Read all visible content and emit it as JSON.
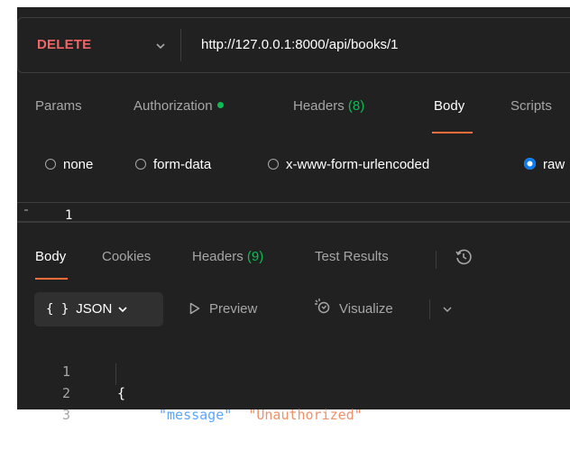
{
  "request": {
    "method": "DELETE",
    "url": "http://127.0.0.1:8000/api/books/1"
  },
  "request_tabs": [
    {
      "label": "Params",
      "active": false
    },
    {
      "label": "Authorization",
      "active": false
    },
    {
      "label": "Headers",
      "count": "(8)",
      "active": false
    },
    {
      "label": "Body",
      "active": true
    },
    {
      "label": "Scripts",
      "active": false
    }
  ],
  "body_types": [
    {
      "label": "none",
      "selected": false
    },
    {
      "label": "form-data",
      "selected": false
    },
    {
      "label": "x-www-form-urlencoded",
      "selected": false
    },
    {
      "label": "raw",
      "selected": true
    }
  ],
  "request_editor": {
    "line_number": "1"
  },
  "response_tabs": [
    {
      "label": "Body",
      "active": true
    },
    {
      "label": "Cookies",
      "active": false
    },
    {
      "label": "Headers",
      "count": "(9)",
      "active": false
    },
    {
      "label": "Test Results",
      "active": false
    }
  ],
  "response_toolbar": {
    "format_braces": "{ }",
    "format_label": "JSON",
    "preview_label": "Preview",
    "visualize_label": "Visualize"
  },
  "response_body": {
    "line_numbers": [
      "1",
      "2",
      "3"
    ],
    "open_brace": "{",
    "key": "\"message\"",
    "colon": ": ",
    "value": "\"Unauthorized\"",
    "close_brace": "}"
  },
  "colors": {
    "accent": "#ff6c37",
    "method_delete": "#f06566",
    "count_green": "#0cbb52",
    "radio_blue": "#097bed",
    "json_key": "#5ca6ff",
    "json_string": "#f0916a"
  },
  "icons": [
    "chevron-down-icon",
    "status-dot-icon",
    "radio-icon",
    "history-icon",
    "play-icon",
    "visualize-icon"
  ]
}
